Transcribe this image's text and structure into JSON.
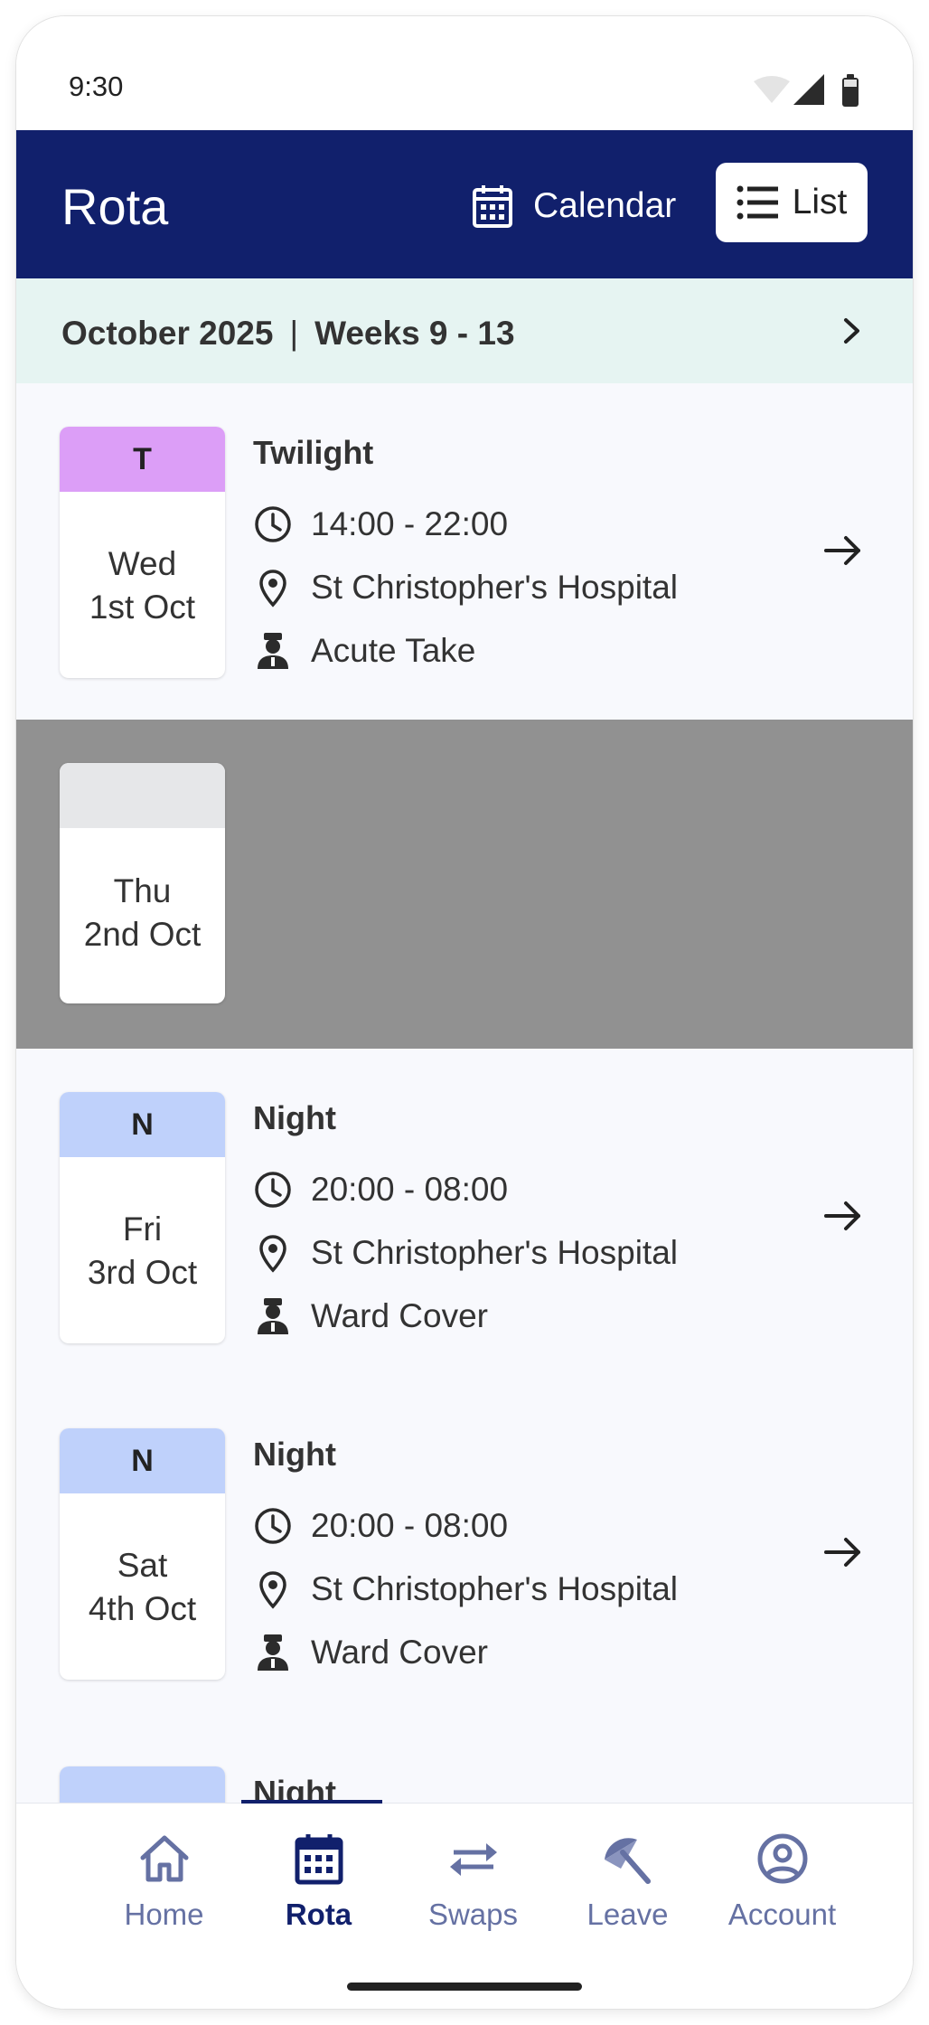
{
  "status_bar": {
    "time": "9:30"
  },
  "app_bar": {
    "title": "Rota",
    "calendar_label": "Calendar",
    "list_label": "List",
    "active_view": "List"
  },
  "period": {
    "month": "October 2025",
    "weeks": "Weeks 9 - 13"
  },
  "shifts": [
    {
      "code": "T",
      "code_color": "#dc9ef7",
      "day": "Wed",
      "date": "1st Oct",
      "type": "Twilight",
      "time": "14:00 - 22:00",
      "location": "St Christopher's Hospital",
      "role": "Acute Take"
    },
    {
      "code": "",
      "code_color": "#e6e7e9",
      "day": "Thu",
      "date": "2nd Oct",
      "off": true
    },
    {
      "code": "N",
      "code_color": "#bfd1fb",
      "day": "Fri",
      "date": "3rd Oct",
      "type": "Night",
      "time": "20:00 - 08:00",
      "location": "St Christopher's Hospital",
      "role": "Ward Cover"
    },
    {
      "code": "N",
      "code_color": "#bfd1fb",
      "day": "Sat",
      "date": "4th Oct",
      "type": "Night",
      "time": "20:00 - 08:00",
      "location": "St Christopher's Hospital",
      "role": "Ward Cover"
    },
    {
      "code": "",
      "code_color": "#bfd1fb",
      "day": "",
      "date": "",
      "type": "Night",
      "partial": true
    }
  ],
  "bottom_nav": {
    "items": [
      {
        "label": "Home",
        "icon": "home-icon"
      },
      {
        "label": "Rota",
        "icon": "calendar-icon",
        "active": true
      },
      {
        "label": "Swaps",
        "icon": "swap-arrows-icon"
      },
      {
        "label": "Leave",
        "icon": "beach-umbrella-icon"
      },
      {
        "label": "Account",
        "icon": "account-circle-icon"
      }
    ]
  },
  "colors": {
    "primary": "#11206c",
    "period_background": "#e6f4f2",
    "list_background": "#f8f9fd",
    "off_day_background": "#919191",
    "nav_inactive": "#6571a3"
  }
}
